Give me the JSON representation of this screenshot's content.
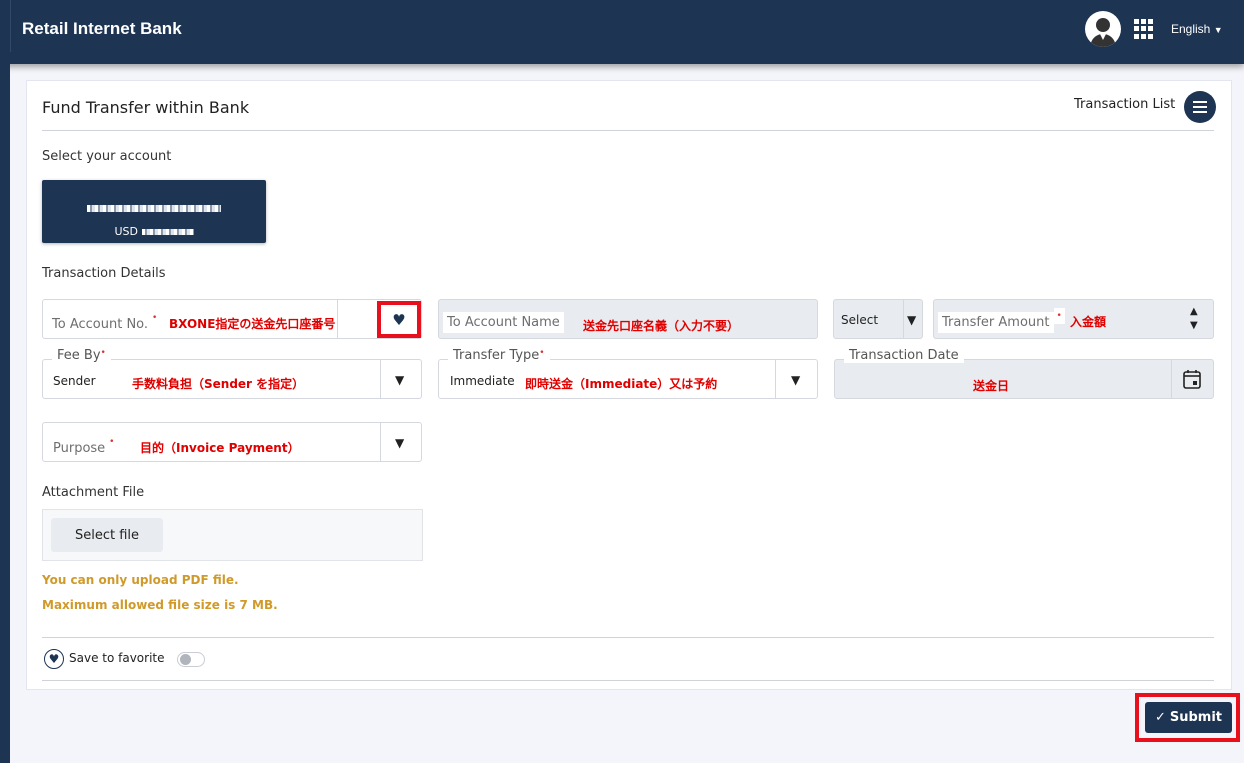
{
  "header": {
    "brand": "Retail Internet Bank",
    "language": "English"
  },
  "page": {
    "title": "Fund Transfer within Bank",
    "transaction_list": "Transaction List"
  },
  "account": {
    "section_label": "Select your account",
    "currency": "USD"
  },
  "details": {
    "section_label": "Transaction Details",
    "to_account_no": {
      "placeholder": "To Account No.",
      "annotation": "BXONE指定の送金先口座番号"
    },
    "to_account_name": {
      "placeholder": "To Account Name",
      "annotation": "送金先口座名義（入力不要）"
    },
    "currency_select": {
      "value": "Select"
    },
    "transfer_amount": {
      "placeholder": "Transfer Amount",
      "annotation": "入金額"
    },
    "fee_by": {
      "label": "Fee By",
      "value": "Sender",
      "annotation": "手数料負担（Sender を指定）"
    },
    "transfer_type": {
      "label": "Transfer Type",
      "value": "Immediate",
      "annotation": "即時送金（Immediate）又は予約"
    },
    "transaction_date": {
      "label": "Transaction Date",
      "annotation": "送金日"
    },
    "purpose": {
      "placeholder": "Purpose",
      "annotation": "目的（Invoice Payment）"
    },
    "required_mark": "•"
  },
  "attachment": {
    "label": "Attachment File",
    "button": "Select file",
    "hint_1": "You can only upload PDF file.",
    "hint_2": "Maximum allowed file size is 7 MB."
  },
  "favorite": {
    "label": "Save to favorite",
    "enabled": false
  },
  "submit": {
    "label": "Submit",
    "icon": "check-icon"
  },
  "colors": {
    "primary": "#1d3452",
    "annotation": "#e00000",
    "hint": "#d09a2a",
    "highlight_box": "#e8101c"
  }
}
